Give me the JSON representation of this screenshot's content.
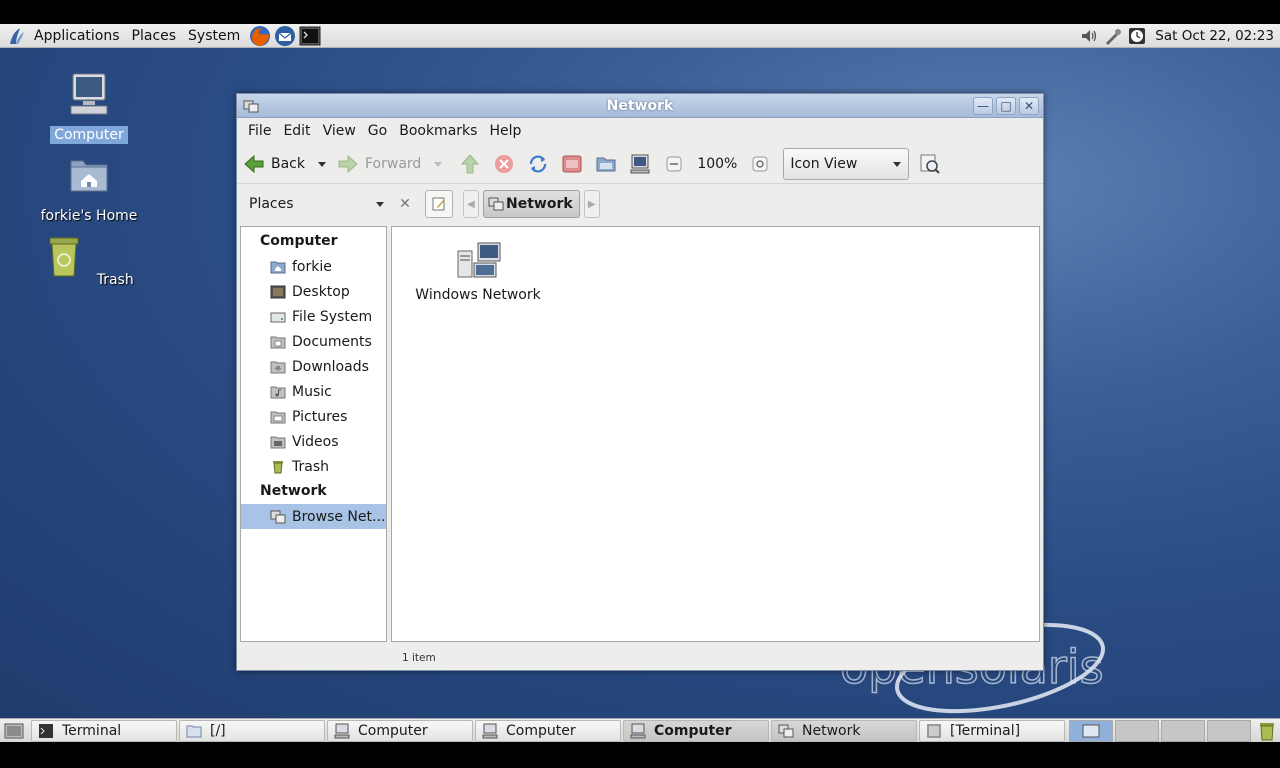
{
  "top_panel": {
    "menus": [
      "Applications",
      "Places",
      "System"
    ],
    "clock": "Sat Oct 22, 02:23"
  },
  "desktop": {
    "icons": [
      {
        "label": "Computer",
        "icon": "computer-icon",
        "selected": true
      },
      {
        "label": "forkie's Home",
        "icon": "home-folder-icon",
        "selected": false
      },
      {
        "label": "Trash",
        "icon": "trash-icon",
        "selected": false
      }
    ]
  },
  "window": {
    "title": "Network",
    "menubar": [
      "File",
      "Edit",
      "View",
      "Go",
      "Bookmarks",
      "Help"
    ],
    "toolbar": {
      "back_label": "Back",
      "forward_label": "Forward",
      "zoom": "100%",
      "view_mode": "Icon View"
    },
    "location": {
      "side_pane_label": "Places",
      "crumb": "Network"
    },
    "sidebar": {
      "computer_header": "Computer",
      "computer_items": [
        "forkie",
        "Desktop",
        "File System",
        "Documents",
        "Downloads",
        "Music",
        "Pictures",
        "Videos",
        "Trash"
      ],
      "network_header": "Network",
      "network_items": [
        "Browse Net..."
      ]
    },
    "files": [
      {
        "label": "Windows Network",
        "icon": "network-computers-icon"
      }
    ],
    "status": "1 item"
  },
  "taskbar": {
    "tasks": [
      {
        "label": "Terminal",
        "icon": "terminal-icon"
      },
      {
        "label": "[/]",
        "icon": "folder-icon"
      },
      {
        "label": "Computer",
        "icon": "computer-icon"
      },
      {
        "label": "Computer",
        "icon": "computer-icon"
      },
      {
        "label": "Computer",
        "icon": "computer-icon"
      },
      {
        "label": "Network",
        "icon": "network-icon"
      },
      {
        "label": "[Terminal]",
        "icon": "terminal-icon"
      }
    ],
    "active_index": 4
  },
  "colors": {
    "desktop_blue": "#2a4c84",
    "titlebar": "#a5bbd9",
    "selection": "#a8c3e6"
  }
}
